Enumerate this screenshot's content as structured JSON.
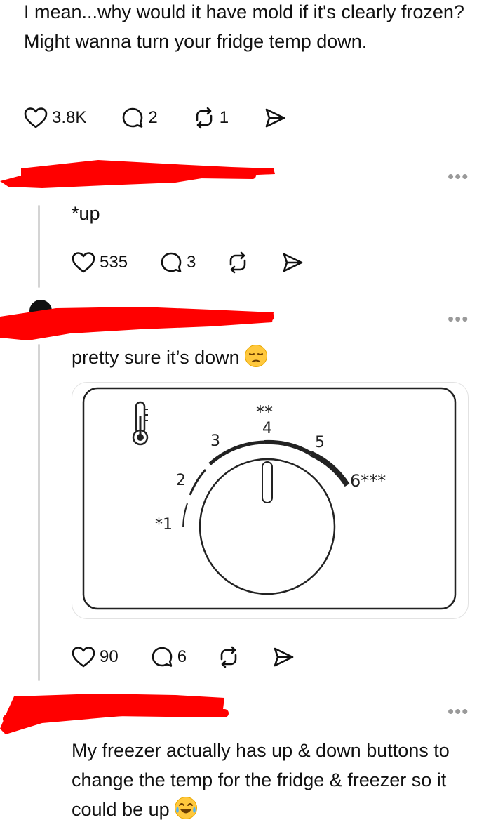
{
  "post1": {
    "text": "I mean...why would it have mold if it's clearly frozen? Might wanna turn your fridge temp down.",
    "likes": "3.8K",
    "comments": "2",
    "reposts": "1"
  },
  "reply1": {
    "text": "*up",
    "likes": "535",
    "comments": "3",
    "more_label": "•••"
  },
  "reply2": {
    "text": "pretty sure it’s down",
    "emoji": "pensive-face-emoji",
    "dial": {
      "labels": [
        "*1",
        "2",
        "3",
        "4",
        "**",
        "5",
        "6***"
      ]
    },
    "likes": "90",
    "comments": "6",
    "more_label": "•••"
  },
  "reply3": {
    "text": "My freezer actually has up & down buttons to change the temp for the fridge & freezer so it could be up",
    "emoji": "tears-of-joy-emoji",
    "more_label": "•••"
  },
  "icons": {
    "like": "heart-icon",
    "comment": "comment-bubble-icon",
    "repost": "repost-icon",
    "share": "send-icon",
    "thermometer": "thermometer-icon"
  },
  "colors": {
    "redaction": "#ff0000",
    "text": "#111111",
    "muted": "#9a9a9a"
  }
}
